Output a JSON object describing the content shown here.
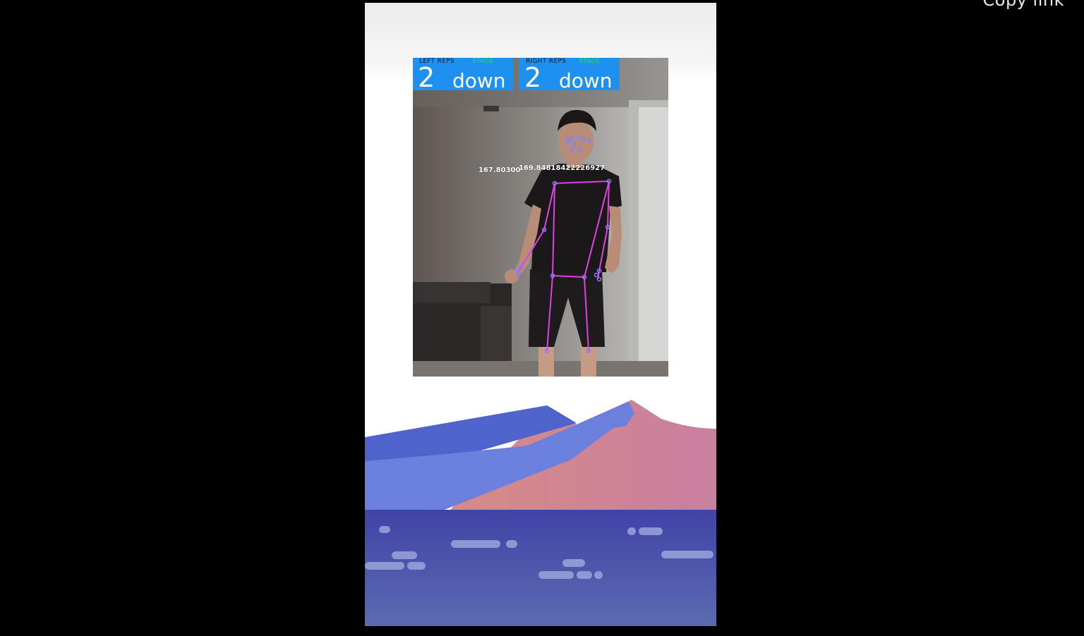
{
  "overlay": {
    "copy_link": "Copy link"
  },
  "counters": {
    "left": {
      "label": "LEFT REPS",
      "stage_label": "STAGE",
      "reps": "2",
      "stage": "down"
    },
    "right": {
      "label": "RIGHT REPS",
      "stage_label": "STAGE",
      "reps": "2",
      "stage": "down"
    }
  },
  "angles": {
    "left_elbow": "167.80300",
    "right_elbow": "169.84818422226927"
  },
  "colors": {
    "counter_bg": "#1e90f0",
    "stage_label": "#22e06a",
    "skeleton": "#e040e0",
    "landmark": "#8080ff"
  }
}
